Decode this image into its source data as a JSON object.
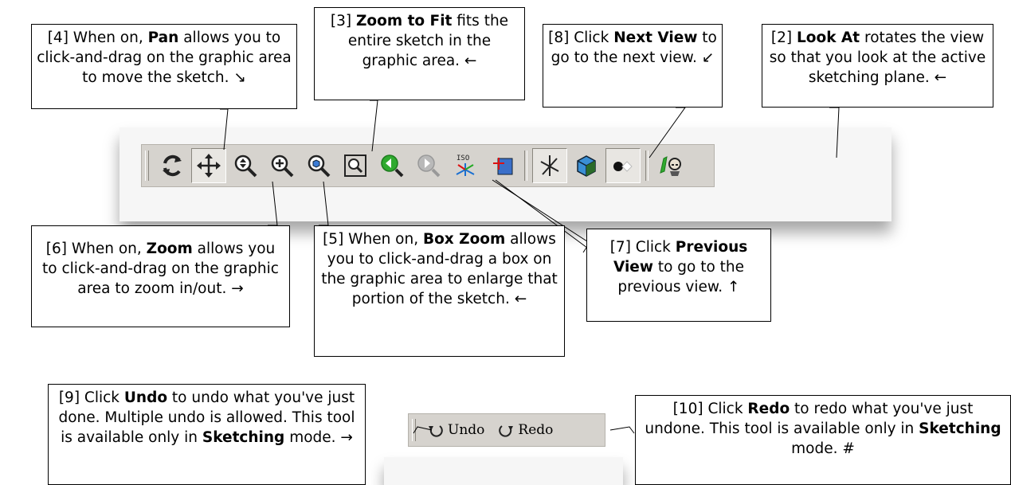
{
  "callouts": {
    "pan": {
      "pre": "[4] When on, ",
      "name": "Pan",
      "post": " allows you to click-and-drag on the graphic area to move the sketch. ↘"
    },
    "zoom_fit": {
      "pre": "[3] ",
      "name": "Zoom to Fit",
      "post": " fits the entire sketch in the graphic area. ←"
    },
    "next": {
      "pre": "[8] Click ",
      "name": "Next View",
      "post": " to go to the next view. ↙"
    },
    "look_at": {
      "pre": "[2] ",
      "name": "Look At",
      "post": " rotates the view so that you look at the active sketching plane. ←"
    },
    "zoom": {
      "pre": "[6] When on, ",
      "name": "Zoom",
      "post": " allows you to click-and-drag on the graphic area to zoom in/out. →"
    },
    "box_zoom": {
      "pre": "[5] When on, ",
      "name": "Box Zoom",
      "post": " allows you to click-and-drag a box on the graphic area to enlarge that portion of the sketch. ←"
    },
    "previous": {
      "pre": "[7] Click ",
      "name": "Previous View",
      "post": " to go to the previous view. ↑"
    },
    "undo": {
      "pre": "[9] Click ",
      "name": "Undo",
      "post": " to undo what you've just done. Multiple undo is allowed. This tool is available only in ",
      "name2": "Sketching",
      "post2": " mode. →"
    },
    "redo": {
      "pre": "[10] Click ",
      "name": "Redo",
      "post": " to redo what you've just undone. This tool is available only in ",
      "name2": "Sketching",
      "post2": " mode. #"
    }
  },
  "toolbar_icons": [
    "rotate-icon",
    "pan-icon",
    "zoom-icon",
    "box-zoom-icon",
    "zoom-to-fit-icon",
    "zoom-window-icon",
    "previous-view-icon",
    "next-view-icon",
    "iso-view-icon",
    "sketch-plane-icon",
    "triad-icon",
    "cube-icon",
    "shading-icon",
    "look-at-icon"
  ],
  "undo_bar": {
    "undo_label": "Undo",
    "redo_label": "Redo"
  },
  "colors": {
    "toolbar_bg": "#d6d3ce",
    "accent_green": "#2faa2f",
    "accent_blue": "#1a6fd1"
  }
}
